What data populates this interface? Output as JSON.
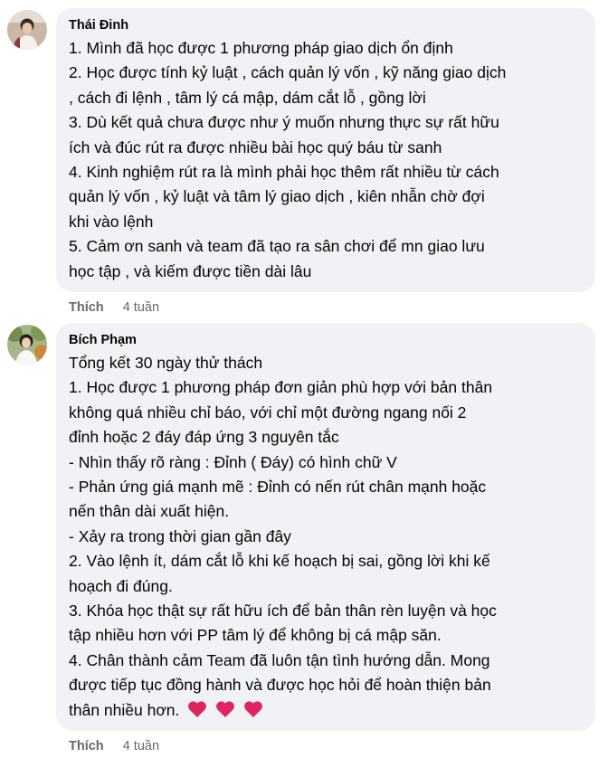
{
  "comments": [
    {
      "author": "Thái Đinh",
      "lines": [
        "1. Mình đã học được 1 phương pháp giao dịch ổn định",
        "2. Học được tính kỷ luật , cách quản lý vốn , kỹ năng giao dịch",
        ", cách đi lệnh , tâm lý cá mập, dám cắt lỗ , gồng lời",
        "3. Dù kết quả chưa được như ý muốn nhưng thực sự rất hữu",
        "ích và đúc rút ra được nhiều bài học quý báu từ sanh",
        "4. Kinh nghiệm rút ra là mình phải học thêm rất nhiều từ cách",
        "quản lý vốn , kỷ luật và tâm lý giao dịch , kiên nhẫn chờ đợi",
        "khi vào lệnh",
        "5. Cảm ơn sanh và team đã tạo ra sân chơi để mn giao lưu",
        "học tập , và kiếm được tiền dài lâu"
      ],
      "like_label": "Thích",
      "time": "4 tuần"
    },
    {
      "author": "Bích Phạm",
      "lines": [
        "Tổng kết 30 ngày thử thách",
        "1. Học được 1 phương pháp đơn giản phù hợp với bản thân",
        "không quá nhiều chỉ báo, với chỉ một đường ngang nối 2",
        "đỉnh hoặc 2 đáy đáp ứng 3 nguyên tắc",
        "- Nhìn thấy rõ ràng : Đỉnh ( Đáy) có hình chữ V",
        "- Phản ứng giá mạnh mẽ : Đỉnh có nến rút chân mạnh hoặc",
        "nến thân dài xuất hiện.",
        "- Xảy ra trong thời gian gần đây",
        "2. Vào lệnh ít, dám cắt lỗ khi kế hoạch bị sai, gồng lời khi kế",
        "hoạch đi đúng.",
        "3. Khóa học thật sự rất hữu ích để bản thân rèn luyện và học",
        "tập nhiều hơn với PP tâm lý để không bị cá mập săn.",
        "4. Chân thành cảm Team đã luôn tận tình hướng dẫn. Mong",
        "được tiếp tục đồng hành và được học hỏi để hoàn thiện bản",
        "thân nhiều hơn."
      ],
      "emoji": [
        "❤",
        "❤",
        "❤"
      ],
      "like_label": "Thích",
      "time": "4 tuần"
    }
  ],
  "colors": {
    "bubble": "#f0f2f5",
    "meta": "#65676b",
    "heart": "#e0245e"
  },
  "icons": [
    "heart-emoji"
  ]
}
